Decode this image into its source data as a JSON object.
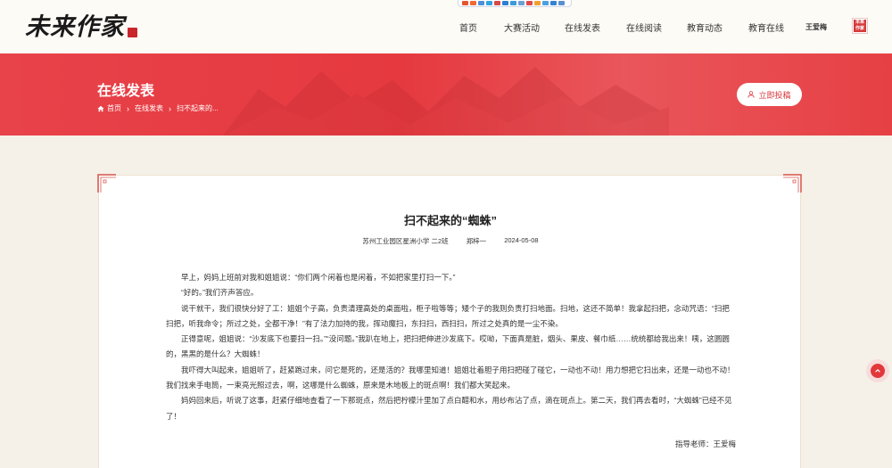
{
  "header": {
    "logo_text": "未来作家",
    "nav": [
      {
        "label": "首页"
      },
      {
        "label": "大赛活动"
      },
      {
        "label": "在线发表"
      },
      {
        "label": "在线阅读"
      },
      {
        "label": "教育动态"
      },
      {
        "label": "教育在线"
      }
    ],
    "user_name": "王爱梅",
    "avatar_text": "未来作家"
  },
  "banner": {
    "title": "在线发表",
    "breadcrumb": [
      "首页",
      "在线发表",
      "扫不起来的..."
    ],
    "submit_label": "立即投稿"
  },
  "article": {
    "title": "扫不起来的“蜘蛛”",
    "school": "苏州工业园区星洲小学 二2班",
    "author": "郑梓一",
    "date": "2024-05-08",
    "paragraphs": [
      "早上，妈妈上班前对我和姐姐说：“你们两个闲着也是闲着，不如把家里打扫一下。”",
      "“好的。”我们齐声答应。",
      "说干就干，我们很快分好了工：姐姐个子高，负责清理高处的桌面啦，柜子啦等等；矮个子的我则负责打扫地面。扫地，这还不简单！我拿起扫把，念动咒语：“扫把扫把，听我命令；所过之处，全都干净！”有了法力加持的我，挥动魔扫，东扫扫，西扫扫，所过之处真的是一尘不染。",
      "正得意呢，姐姐说：“沙发底下也要扫一扫。”“没问题。”我趴在地上，把扫把伸进沙发底下。哎呦，下面真是脏，烟头、果皮、餐巾纸……统统都给我出来！咦，这圆圆的，黑黑的是什么？大蜘蛛！",
      "我吓得大叫起来，姐姐听了，赶紧跑过来，问它是死的，还是活的？我哪里知道！姐姐壮着胆子用扫把碰了碰它，一动也不动！用力想把它扫出来，还是一动也不动！我们找来手电筒，一束亮光照过去，啊，这哪是什么蜘蛛，原来是木地板上的斑点啊！我们都大笑起来。",
      "妈妈回来后，听说了这事，赶紧仔细地查看了一下那斑点，然后把柠檬汁里加了点白醋和水，用纱布沾了点，滴在斑点上。第二天，我们再去看时，“大蜘蛛”已经不见了！"
    ],
    "teacher": "指导老师：王爱梅"
  },
  "colors": {
    "accent": "#e5393f",
    "background": "#f5f1e8"
  }
}
